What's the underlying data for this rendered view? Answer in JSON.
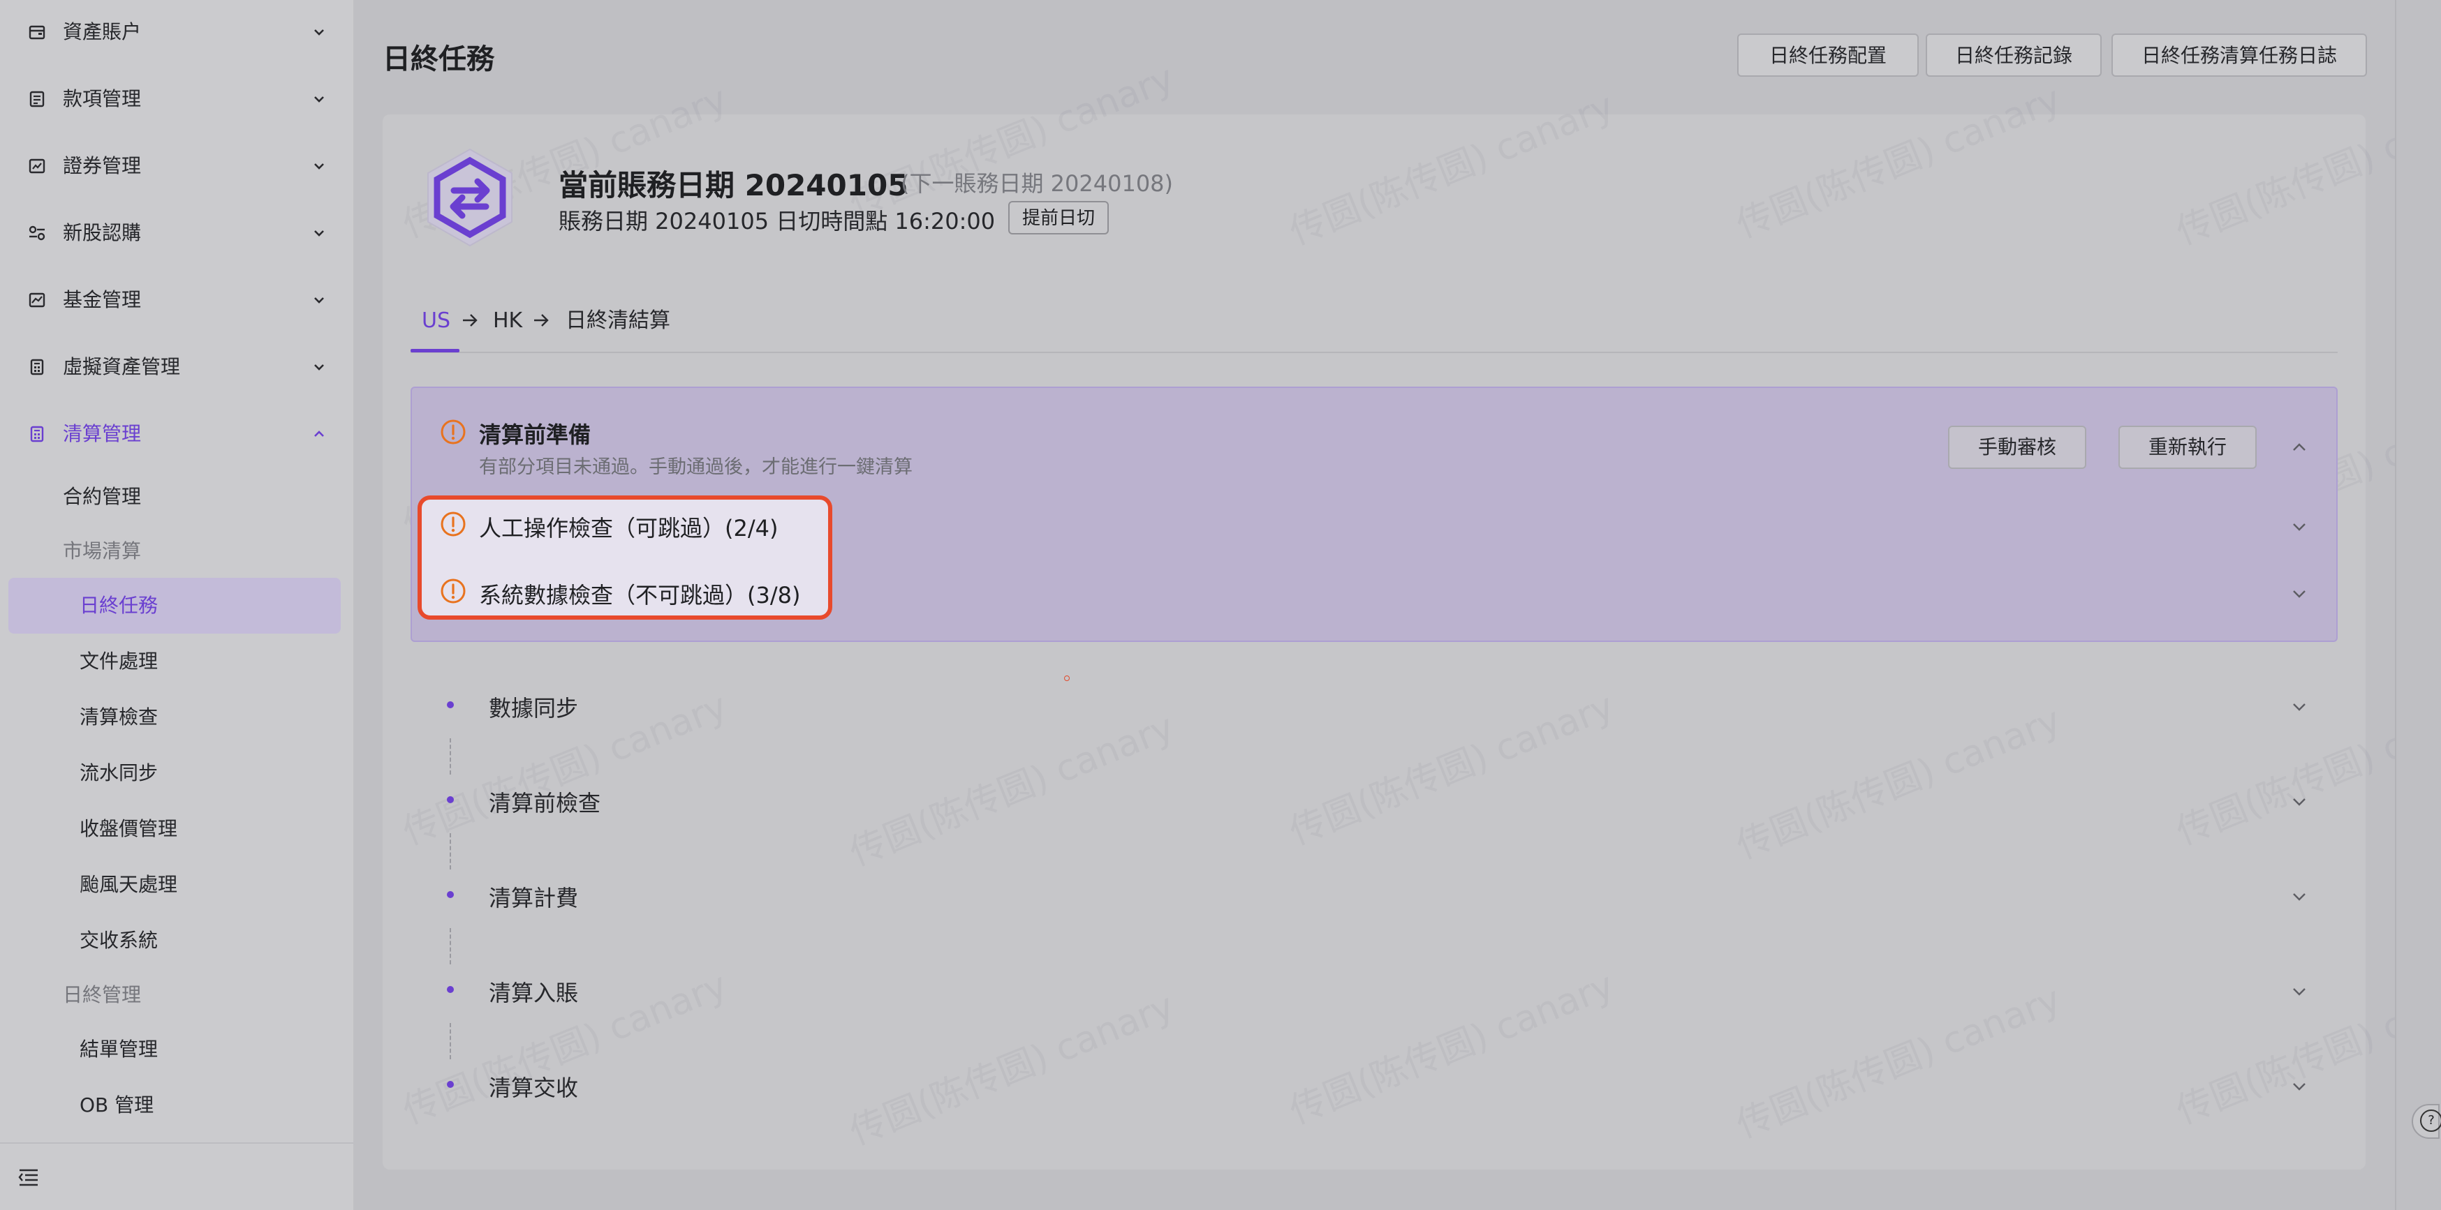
{
  "sidebar": {
    "groups": [
      {
        "label": "資產賬户",
        "icon": "wallet-icon"
      },
      {
        "label": "款項管理",
        "icon": "document-icon"
      },
      {
        "label": "證券管理",
        "icon": "chart-icon"
      },
      {
        "label": "新股認購",
        "icon": "ipo-icon"
      },
      {
        "label": "基金管理",
        "icon": "fund-icon"
      },
      {
        "label": "虛擬資產管理",
        "icon": "calculator-icon"
      },
      {
        "label": "清算管理",
        "icon": "calculator-icon",
        "expanded": true
      }
    ],
    "items": [
      "合約管理",
      "市場清算",
      "日終任務",
      "文件處理",
      "清算檢查",
      "流水同步",
      "收盤價管理",
      "颱風天處理",
      "交收系統",
      "日終管理",
      "結單管理",
      "OB 管理"
    ],
    "selected": "日終任務",
    "collapse_icon": "menu-collapse-icon"
  },
  "header": {
    "title": "日終任務",
    "buttons": [
      "日終任務配置",
      "日終任務記錄",
      "日終任務清算任務日誌"
    ]
  },
  "summary": {
    "title": "當前賬務日期  20240105",
    "next": "(下一賬務日期  20240108)",
    "sub": "賬務日期 20240105   日切時間點 16:20:00",
    "advance_button": "提前日切"
  },
  "tabs": [
    "US",
    "HK",
    "日終清結算"
  ],
  "active_tab": "US",
  "prep": {
    "title": "清算前準備",
    "desc": "有部分項目未通過。手動通過後，才能進行一鍵清算",
    "buttons": [
      "手動審核",
      "重新執行"
    ],
    "checks": [
      "人工操作檢查（可跳過）(2/4)",
      "系統數據檢查（不可跳過）(3/8)"
    ]
  },
  "steps": [
    "數據同步",
    "清算前檢查",
    "清算計費",
    "清算入賬",
    "清算交收"
  ],
  "watermark": "传圆(陈传圆) canary",
  "help_icon": "?",
  "colors": {
    "accent": "#6a3fd0",
    "warning": "#e8731f",
    "highlight": "#e84a2c"
  }
}
